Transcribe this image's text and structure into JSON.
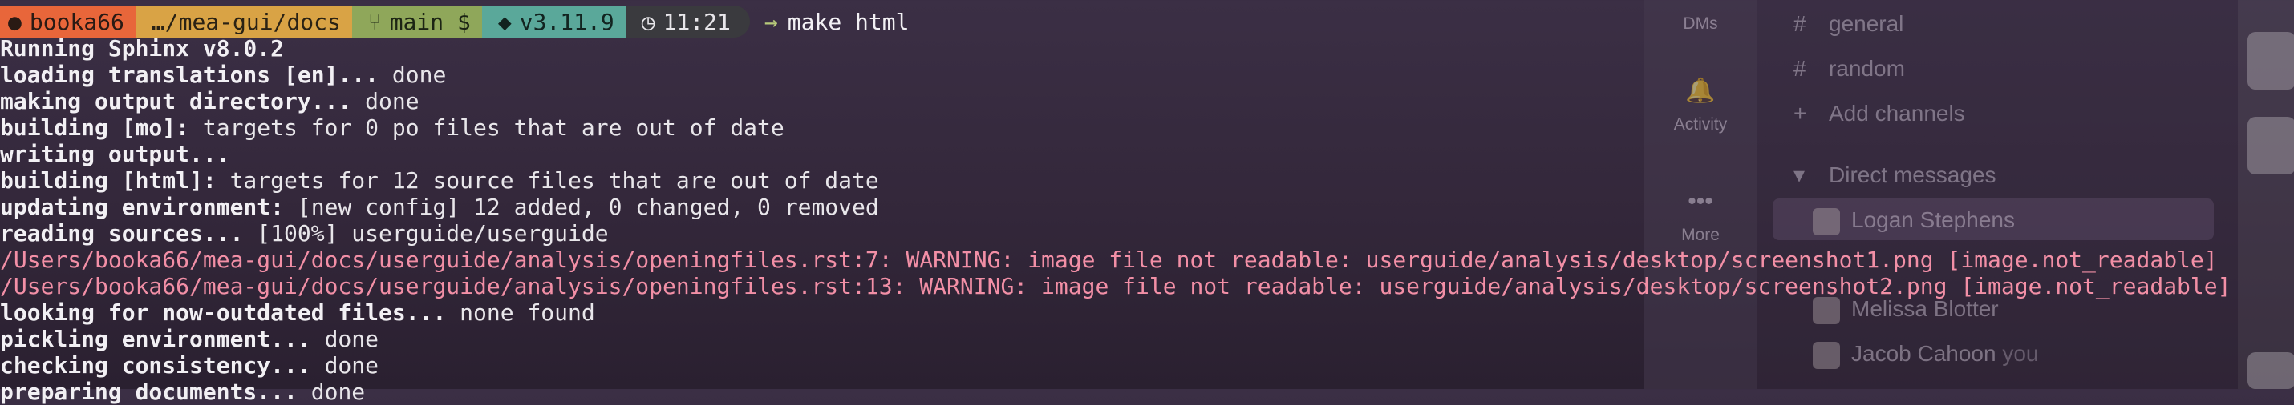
{
  "prompt": {
    "user": "booka66",
    "path": "…/mea-gui/docs",
    "git": "main $",
    "python": "v3.11.9",
    "time": "11:21",
    "arrow": "→",
    "command": "make html"
  },
  "output": [
    {
      "bold": "Running Sphinx v8.0.2",
      "rest": "",
      "kind": "normal"
    },
    {
      "bold": "loading translations [en]... ",
      "rest": "done",
      "kind": "normal"
    },
    {
      "bold": "making output directory... ",
      "rest": "done",
      "kind": "normal"
    },
    {
      "bold": "building [mo]: ",
      "rest": "targets for 0 po files that are out of date",
      "kind": "normal"
    },
    {
      "bold": "writing output...",
      "rest": "",
      "kind": "normal"
    },
    {
      "bold": "building [html]: ",
      "rest": "targets for 12 source files that are out of date",
      "kind": "normal"
    },
    {
      "bold": "updating environment: ",
      "rest": "[new config] 12 added, 0 changed, 0 removed",
      "kind": "normal"
    },
    {
      "bold": "reading sources... ",
      "rest": "[100%] userguide/userguide",
      "kind": "normal"
    },
    {
      "bold": "",
      "rest": "/Users/booka66/mea-gui/docs/userguide/analysis/openingfiles.rst:7: WARNING: image file not readable: userguide/analysis/desktop/screenshot1.png [image.not_readable]",
      "kind": "warn"
    },
    {
      "bold": "",
      "rest": "/Users/booka66/mea-gui/docs/userguide/analysis/openingfiles.rst:13: WARNING: image file not readable: userguide/analysis/desktop/screenshot2.png [image.not_readable]",
      "kind": "warn"
    },
    {
      "bold": "looking for now-outdated files... ",
      "rest": "none found",
      "kind": "normal"
    },
    {
      "bold": "pickling environment... ",
      "rest": "done",
      "kind": "normal"
    },
    {
      "bold": "checking consistency... ",
      "rest": "done",
      "kind": "normal"
    },
    {
      "bold": "preparing documents... ",
      "rest": "done",
      "kind": "normal"
    }
  ],
  "slack": {
    "rail": {
      "dms": "DMs",
      "activity": "Activity",
      "more": "More"
    },
    "channels": [
      {
        "prefix": "#",
        "name": "general"
      },
      {
        "prefix": "#",
        "name": "random"
      },
      {
        "prefix": "+",
        "name": "Add channels"
      }
    ],
    "dm_header": "Direct messages",
    "dms": [
      {
        "name": "Logan Stephens",
        "suffix": ""
      },
      {
        "name": "Melissa Blotter",
        "suffix": ""
      },
      {
        "name": "Jacob Cahoon",
        "suffix": "you"
      }
    ]
  },
  "colors": {
    "seg_user": "#e8663a",
    "seg_path": "#d9a345",
    "seg_git": "#8fa75a",
    "seg_python": "#5aa89a",
    "seg_time": "#3a3a3e",
    "warning": "#f28fa6"
  }
}
